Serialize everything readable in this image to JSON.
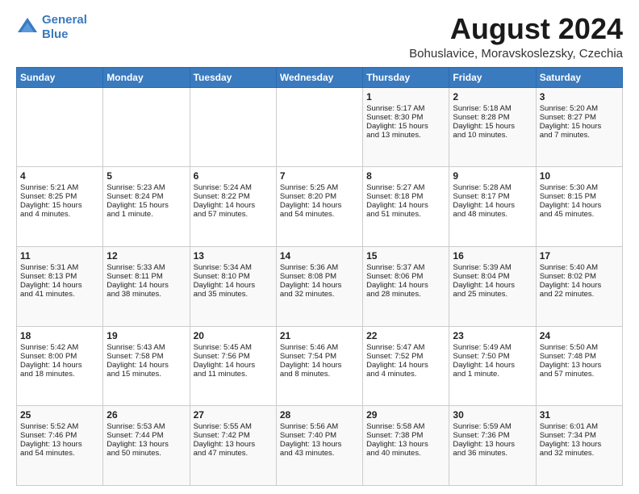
{
  "logo": {
    "line1": "General",
    "line2": "Blue"
  },
  "title": "August 2024",
  "location": "Bohuslavice, Moravskoslezsky, Czechia",
  "days_header": [
    "Sunday",
    "Monday",
    "Tuesday",
    "Wednesday",
    "Thursday",
    "Friday",
    "Saturday"
  ],
  "weeks": [
    [
      {
        "day": "",
        "info": ""
      },
      {
        "day": "",
        "info": ""
      },
      {
        "day": "",
        "info": ""
      },
      {
        "day": "",
        "info": ""
      },
      {
        "day": "1",
        "info": "Sunrise: 5:17 AM\nSunset: 8:30 PM\nDaylight: 15 hours\nand 13 minutes."
      },
      {
        "day": "2",
        "info": "Sunrise: 5:18 AM\nSunset: 8:28 PM\nDaylight: 15 hours\nand 10 minutes."
      },
      {
        "day": "3",
        "info": "Sunrise: 5:20 AM\nSunset: 8:27 PM\nDaylight: 15 hours\nand 7 minutes."
      }
    ],
    [
      {
        "day": "4",
        "info": "Sunrise: 5:21 AM\nSunset: 8:25 PM\nDaylight: 15 hours\nand 4 minutes."
      },
      {
        "day": "5",
        "info": "Sunrise: 5:23 AM\nSunset: 8:24 PM\nDaylight: 15 hours\nand 1 minute."
      },
      {
        "day": "6",
        "info": "Sunrise: 5:24 AM\nSunset: 8:22 PM\nDaylight: 14 hours\nand 57 minutes."
      },
      {
        "day": "7",
        "info": "Sunrise: 5:25 AM\nSunset: 8:20 PM\nDaylight: 14 hours\nand 54 minutes."
      },
      {
        "day": "8",
        "info": "Sunrise: 5:27 AM\nSunset: 8:18 PM\nDaylight: 14 hours\nand 51 minutes."
      },
      {
        "day": "9",
        "info": "Sunrise: 5:28 AM\nSunset: 8:17 PM\nDaylight: 14 hours\nand 48 minutes."
      },
      {
        "day": "10",
        "info": "Sunrise: 5:30 AM\nSunset: 8:15 PM\nDaylight: 14 hours\nand 45 minutes."
      }
    ],
    [
      {
        "day": "11",
        "info": "Sunrise: 5:31 AM\nSunset: 8:13 PM\nDaylight: 14 hours\nand 41 minutes."
      },
      {
        "day": "12",
        "info": "Sunrise: 5:33 AM\nSunset: 8:11 PM\nDaylight: 14 hours\nand 38 minutes."
      },
      {
        "day": "13",
        "info": "Sunrise: 5:34 AM\nSunset: 8:10 PM\nDaylight: 14 hours\nand 35 minutes."
      },
      {
        "day": "14",
        "info": "Sunrise: 5:36 AM\nSunset: 8:08 PM\nDaylight: 14 hours\nand 32 minutes."
      },
      {
        "day": "15",
        "info": "Sunrise: 5:37 AM\nSunset: 8:06 PM\nDaylight: 14 hours\nand 28 minutes."
      },
      {
        "day": "16",
        "info": "Sunrise: 5:39 AM\nSunset: 8:04 PM\nDaylight: 14 hours\nand 25 minutes."
      },
      {
        "day": "17",
        "info": "Sunrise: 5:40 AM\nSunset: 8:02 PM\nDaylight: 14 hours\nand 22 minutes."
      }
    ],
    [
      {
        "day": "18",
        "info": "Sunrise: 5:42 AM\nSunset: 8:00 PM\nDaylight: 14 hours\nand 18 minutes."
      },
      {
        "day": "19",
        "info": "Sunrise: 5:43 AM\nSunset: 7:58 PM\nDaylight: 14 hours\nand 15 minutes."
      },
      {
        "day": "20",
        "info": "Sunrise: 5:45 AM\nSunset: 7:56 PM\nDaylight: 14 hours\nand 11 minutes."
      },
      {
        "day": "21",
        "info": "Sunrise: 5:46 AM\nSunset: 7:54 PM\nDaylight: 14 hours\nand 8 minutes."
      },
      {
        "day": "22",
        "info": "Sunrise: 5:47 AM\nSunset: 7:52 PM\nDaylight: 14 hours\nand 4 minutes."
      },
      {
        "day": "23",
        "info": "Sunrise: 5:49 AM\nSunset: 7:50 PM\nDaylight: 14 hours\nand 1 minute."
      },
      {
        "day": "24",
        "info": "Sunrise: 5:50 AM\nSunset: 7:48 PM\nDaylight: 13 hours\nand 57 minutes."
      }
    ],
    [
      {
        "day": "25",
        "info": "Sunrise: 5:52 AM\nSunset: 7:46 PM\nDaylight: 13 hours\nand 54 minutes."
      },
      {
        "day": "26",
        "info": "Sunrise: 5:53 AM\nSunset: 7:44 PM\nDaylight: 13 hours\nand 50 minutes."
      },
      {
        "day": "27",
        "info": "Sunrise: 5:55 AM\nSunset: 7:42 PM\nDaylight: 13 hours\nand 47 minutes."
      },
      {
        "day": "28",
        "info": "Sunrise: 5:56 AM\nSunset: 7:40 PM\nDaylight: 13 hours\nand 43 minutes."
      },
      {
        "day": "29",
        "info": "Sunrise: 5:58 AM\nSunset: 7:38 PM\nDaylight: 13 hours\nand 40 minutes."
      },
      {
        "day": "30",
        "info": "Sunrise: 5:59 AM\nSunset: 7:36 PM\nDaylight: 13 hours\nand 36 minutes."
      },
      {
        "day": "31",
        "info": "Sunrise: 6:01 AM\nSunset: 7:34 PM\nDaylight: 13 hours\nand 32 minutes."
      }
    ]
  ]
}
